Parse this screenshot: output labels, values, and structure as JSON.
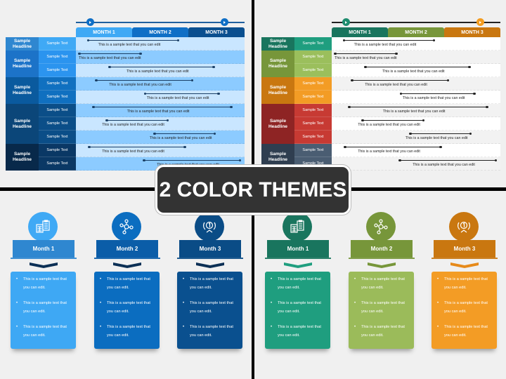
{
  "banner": {
    "title": "2 COLOR THEMES"
  },
  "gantt": {
    "months": [
      "MONTH 1",
      "MONTH 2",
      "MONTH 3"
    ],
    "milestones": [
      0.25,
      2.64
    ],
    "groups": [
      {
        "headline": "Sample Headline",
        "rows": 1
      },
      {
        "headline": "Sample Headline",
        "rows": 2
      },
      {
        "headline": "Sample Headline",
        "rows": 2
      },
      {
        "headline": "Sample Headline",
        "rows": 3
      },
      {
        "headline": "Sample Headline",
        "rows": 2
      }
    ],
    "rows": [
      {
        "label": "Sample Text",
        "text": "This is a sample text that you can edit",
        "start": 0.21,
        "end": 1.83
      },
      {
        "label": "Sample Text",
        "text": "This is a sample text that you can edit",
        "start": 0.05,
        "end": 1.16
      },
      {
        "label": "Sample Text",
        "text": "This is a sample text that you can edit",
        "start": 0.59,
        "end": 2.46
      },
      {
        "label": "Sample Text",
        "text": "This is a sample text that you can edit",
        "start": 0.35,
        "end": 2.08
      },
      {
        "label": "Sample Text",
        "text": "This is a sample text that you can edit",
        "start": 1.22,
        "end": 2.55
      },
      {
        "label": "Sample Text",
        "text": "This is a sample text that you can edit",
        "start": 0.3,
        "end": 2.77
      },
      {
        "label": "Sample Text",
        "text": "This is a sample text that you can edit",
        "start": 0.54,
        "end": 1.64
      },
      {
        "label": "Sample Text",
        "text": "This is a sample text that you can edit",
        "start": 1.39,
        "end": 2.48
      },
      {
        "label": "Sample Text",
        "text": "This is a sample text that you can edit",
        "start": 0.23,
        "end": 1.95
      },
      {
        "label": "Sample Text",
        "text": "This is a sample text that you can edit",
        "start": 1.2,
        "end": 2.93
      }
    ]
  },
  "themes": [
    {
      "name": "blue",
      "line": "#1f5f9e",
      "dot": "#0f6fc6",
      "bar": "#1a3f66",
      "month_colors": [
        "#3fa9f5",
        "#0f6fc6",
        "#0a4f8f"
      ],
      "group_colors": [
        "#2f87d0",
        "#1c73c8",
        "#0a5a9e",
        "#0b4679",
        "#08294a"
      ],
      "sub_colors": [
        "#3fa9f5",
        "#2b94ef",
        "#1070c0",
        "#0b4e88",
        "#0a3865"
      ],
      "cell_colors": [
        "#c9e6ff",
        "#8ccbff"
      ],
      "card_colors": [
        "#3ea8f4",
        "#0b6dc0",
        "#0a508f"
      ],
      "label_colors": [
        "#2f87d0",
        "#0b5da8",
        "#0a4c86"
      ],
      "chev_colors": [
        "#0b2f55",
        "#0b2f55",
        "#0b2f55"
      ],
      "icon_colors": [
        "#3fa9f5",
        "#0b6dc0",
        "#0a4c86"
      ]
    },
    {
      "name": "multi",
      "line": "#222222",
      "dot": "#1e8c6e",
      "dot2": "#f39c1f",
      "bar": "#222222",
      "month_colors": [
        "#19755e",
        "#77963a",
        "#c97710"
      ],
      "group_colors": [
        "#19755e",
        "#77963a",
        "#c97710",
        "#8e2424",
        "#2f3e50"
      ],
      "sub_colors": [
        "#1f9e7f",
        "#9bbf5c",
        "#f39c25",
        "#c73a33",
        "#4a5d72"
      ],
      "cell_colors": [
        "#ffffff",
        "#f2f2f2"
      ],
      "card_colors": [
        "#1f9e7f",
        "#9bbb5a",
        "#f39c25"
      ],
      "label_colors": [
        "#19755e",
        "#77963a",
        "#c97710"
      ],
      "chev_colors": [
        "#1f9e7f",
        "#77963a",
        "#e68a1a"
      ],
      "icon_colors": [
        "#19755e",
        "#77963a",
        "#c97710"
      ]
    }
  ],
  "steps": [
    {
      "label": "Month 1",
      "icon": "calculator-clipboard-icon",
      "bullets": [
        "This is a sample text that you can edit.",
        "This is a sample text that you can edit.",
        "This is a sample text that you can edit."
      ]
    },
    {
      "label": "Month 2",
      "icon": "network-nodes-icon",
      "bullets": [
        "This is a sample text that you can edit.",
        "This is a sample text that you can edit.",
        "This is a sample text that you can edit."
      ]
    },
    {
      "label": "Month 3",
      "icon": "award-laurel-icon",
      "bullets": [
        "This is a sample text that you can edit.",
        "This is a sample text that you can edit.",
        "This is a sample text that you can edit."
      ]
    }
  ]
}
